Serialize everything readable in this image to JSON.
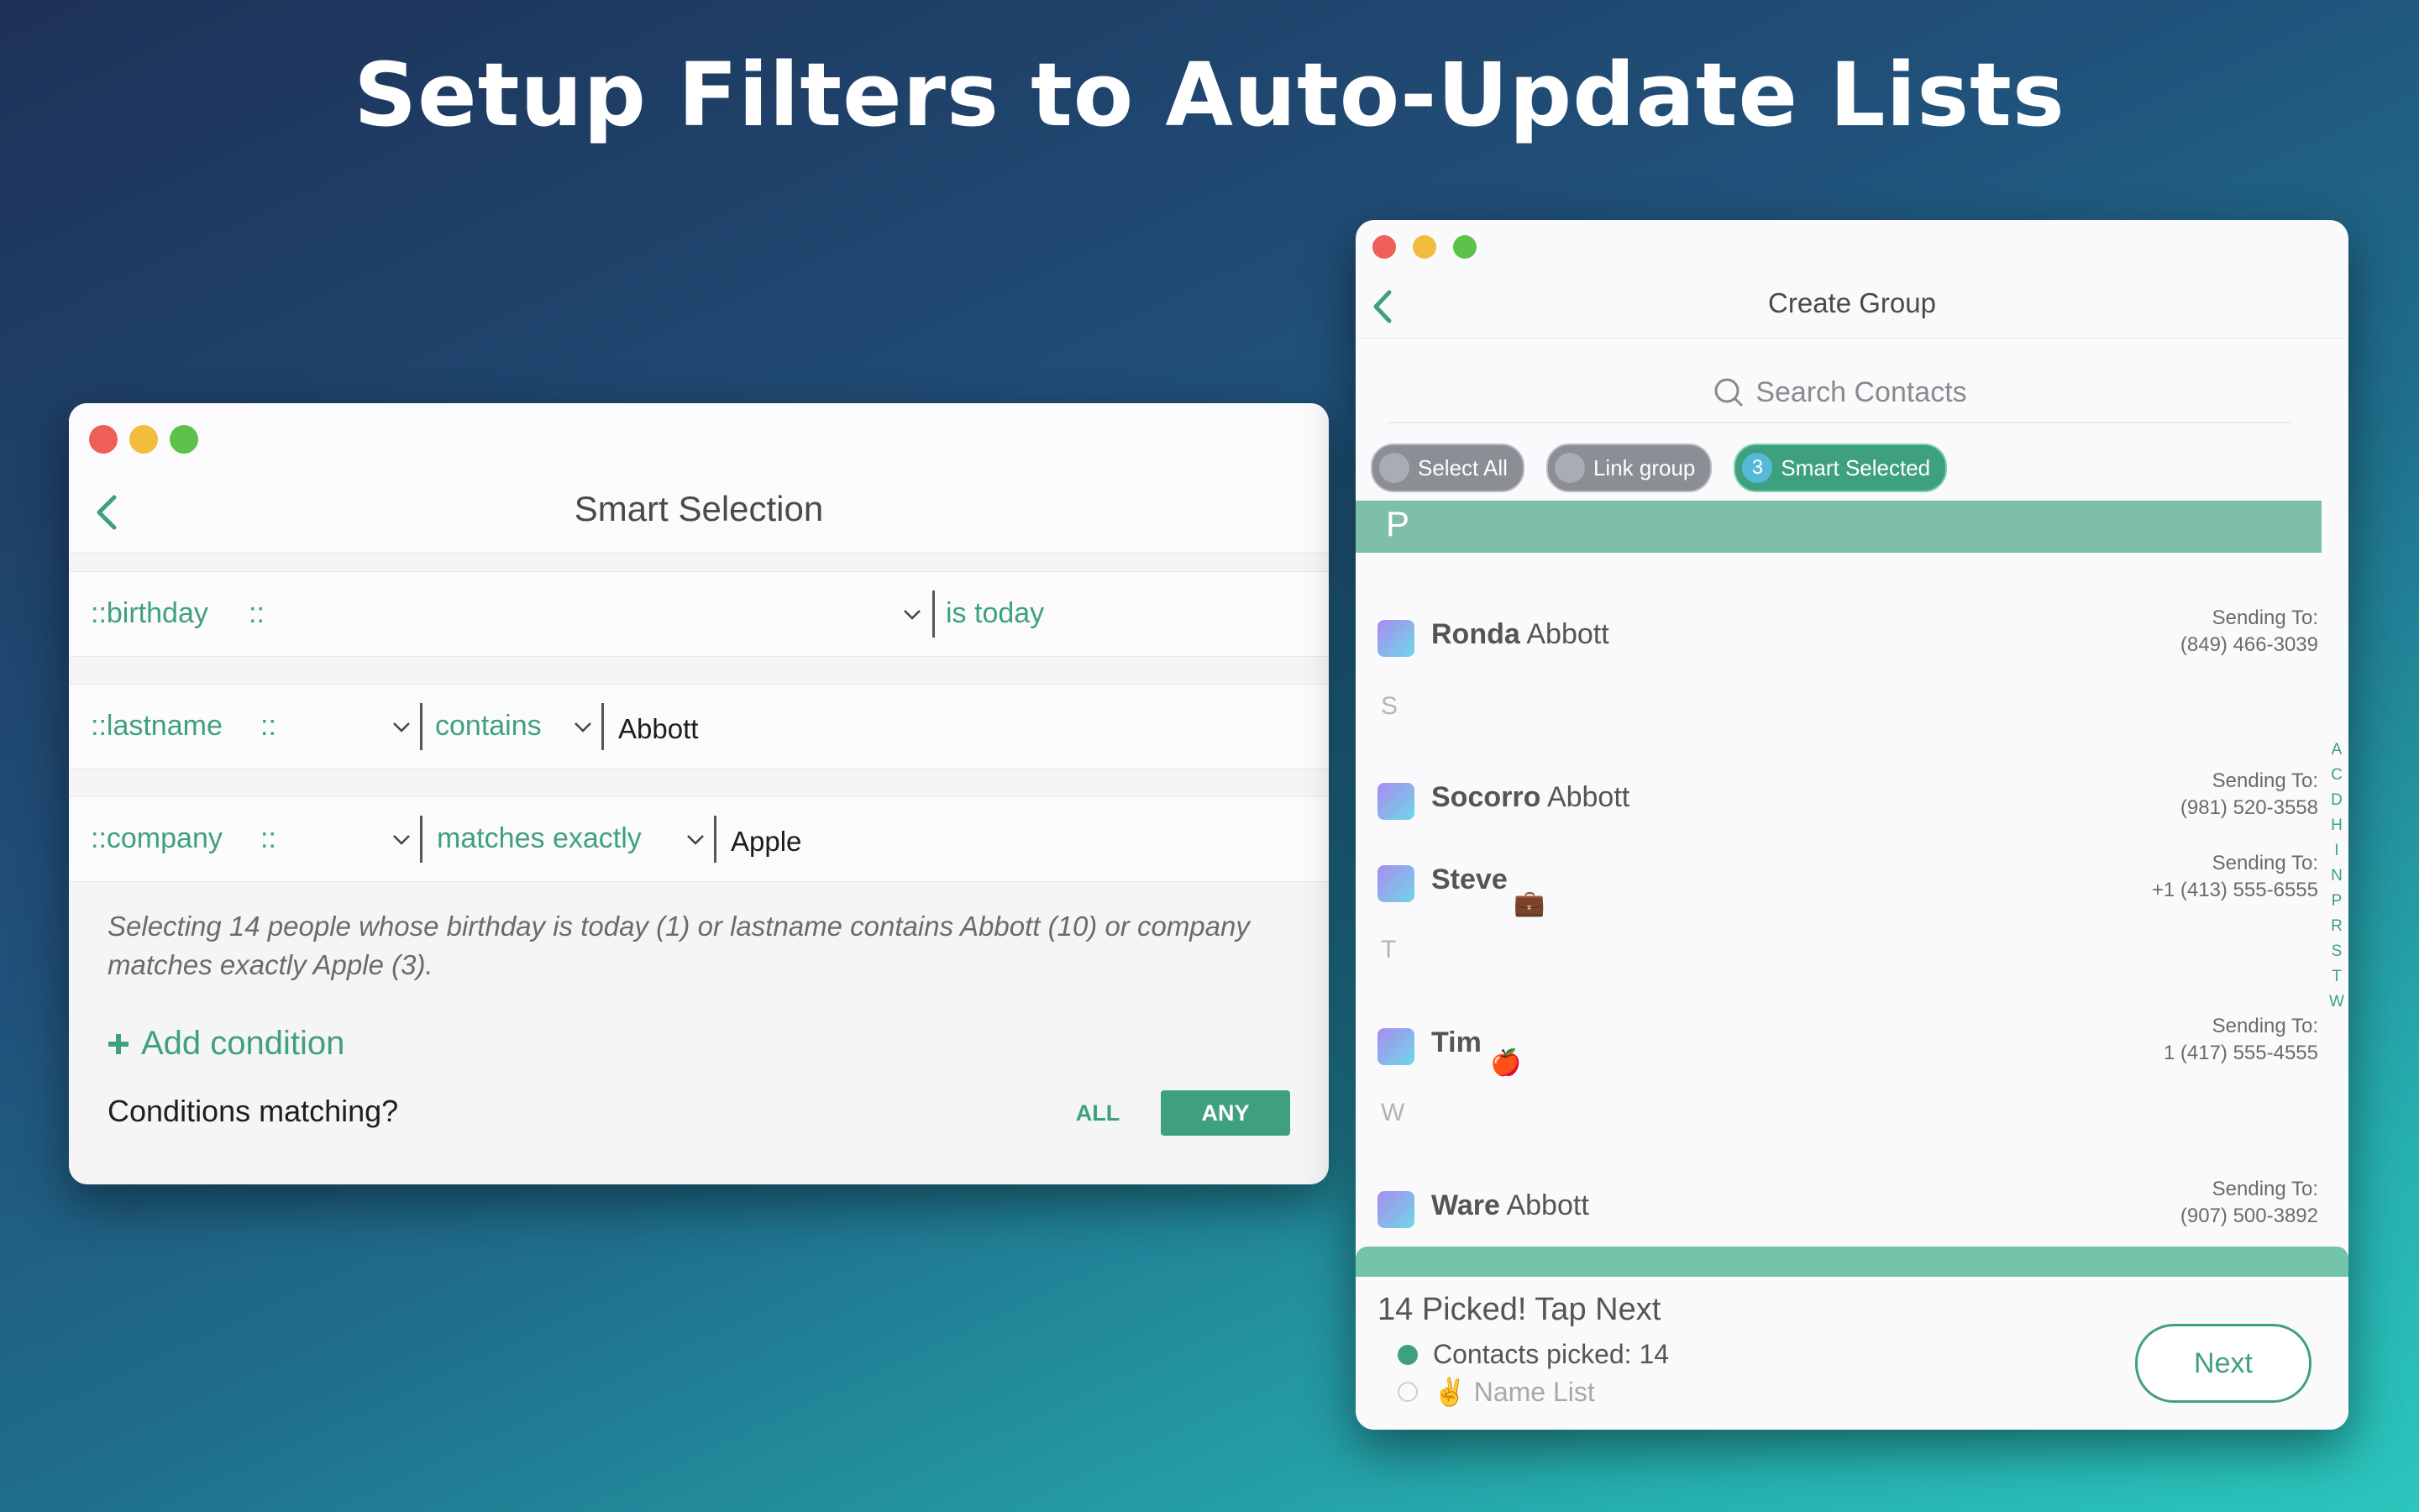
{
  "headline": "Setup Filters to Auto-Update Lists",
  "colors": {
    "accent": "#3fa07f",
    "section": "#7dbfaa"
  },
  "left_window": {
    "title": "Smart Selection",
    "conditions": [
      {
        "field": "::birthday",
        "field_sep": "::",
        "operator": "is today",
        "value": ""
      },
      {
        "field": "::lastname",
        "field_sep": "::",
        "operator": "contains",
        "value": "Abbott"
      },
      {
        "field": "::company",
        "field_sep": "::",
        "operator": "matches exactly",
        "value": "Apple"
      }
    ],
    "summary": "Selecting 14 people whose birthday is today (1) or lastname contains Abbott (10) or company matches exactly Apple (3).",
    "add_condition": "Add condition",
    "matching_question": "Conditions matching?",
    "all_label": "ALL",
    "any_label": "ANY"
  },
  "right_window": {
    "title": "Create Group",
    "search_placeholder": "Search Contacts",
    "chips": [
      {
        "label": "Select All",
        "badge": ""
      },
      {
        "label": "Link group",
        "badge": ""
      },
      {
        "label": "Smart Selected",
        "badge": "3"
      }
    ],
    "section_letters": [
      "P",
      "S",
      "T",
      "W"
    ],
    "contacts": [
      {
        "first": "Ronda",
        "last": "Abbott",
        "emoji": "",
        "sending_label": "Sending To:",
        "phone": "(849) 466-3039"
      },
      {
        "first": "Socorro",
        "last": "Abbott",
        "emoji": "",
        "sending_label": "Sending To:",
        "phone": "(981) 520-3558"
      },
      {
        "first": "Steve",
        "last": "",
        "emoji": "💼",
        "sending_label": "Sending To:",
        "phone": "+1 (413) 555-6555"
      },
      {
        "first": "Tim",
        "last": "",
        "emoji": "🍎",
        "sending_label": "Sending To:",
        "phone": "1 (417) 555-4555"
      },
      {
        "first": "Ware",
        "last": "Abbott",
        "emoji": "",
        "sending_label": "Sending To:",
        "phone": "(907) 500-3892"
      }
    ],
    "index_letters": [
      "A",
      "C",
      "D",
      "H",
      "I",
      "N",
      "P",
      "R",
      "S",
      "T",
      "W"
    ],
    "footer": {
      "picked_text": "14 Picked! Tap Next",
      "contacts_picked": "Contacts picked: 14",
      "name_list": "✌ Name List",
      "next_label": "Next"
    }
  }
}
